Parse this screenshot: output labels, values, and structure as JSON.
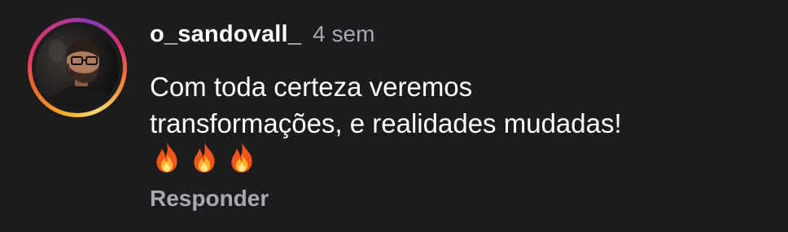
{
  "comment": {
    "username": "o_sandovall_",
    "time": "4 sem",
    "text_lines": [
      "Com toda certeza veremos",
      "transformações, e realidades mudadas!"
    ],
    "emojis": [
      "fire-icon",
      "fire-icon",
      "fire-icon"
    ],
    "reply_label": "Responder"
  },
  "colors": {
    "background": "#1c1c1f",
    "text": "#ffffff",
    "muted": "#a8a8b0"
  }
}
